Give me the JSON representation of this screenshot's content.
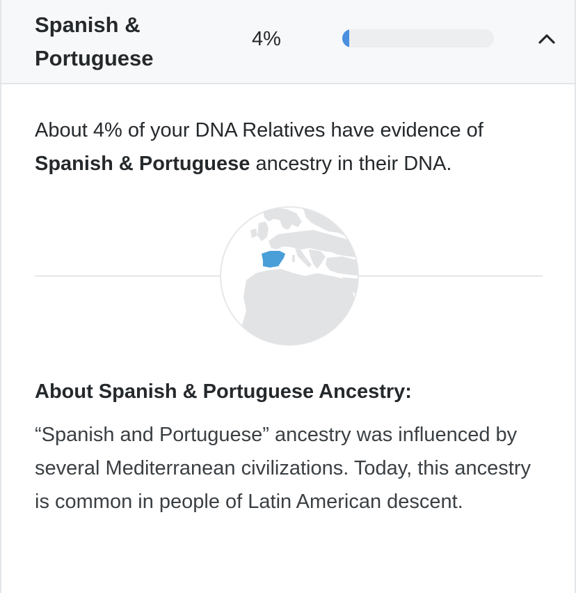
{
  "section": {
    "title": "Spanish & Portuguese",
    "percent_label": "4%",
    "percent_value": 0.04,
    "bar_color": "#4a8fe0",
    "expanded": true,
    "collapse_icon": "chevron-up-icon"
  },
  "intro": {
    "prefix": "About 4% of your DNA Relatives have evidence of ",
    "bold": "Spanish & Portuguese",
    "suffix": " ancestry in their DNA."
  },
  "map": {
    "icon": "globe-map-icon",
    "highlight_color": "#4a9fd8",
    "land_color": "#e2e3e5"
  },
  "about": {
    "heading": "About Spanish & Portuguese Ancestry:",
    "body": "“Spanish and Portuguese” ancestry was influenced by several Mediterranean civilizations. Today, this ancestry is common in people of Latin American descent."
  }
}
